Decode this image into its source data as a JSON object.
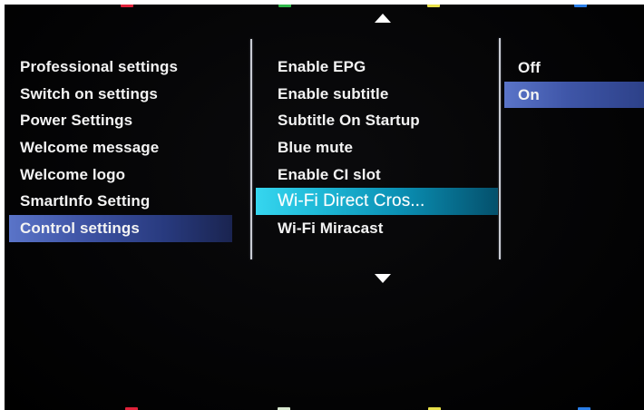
{
  "colors": {
    "background": "#000000",
    "left_selection": "#3d52a3",
    "focus_highlight": "#1fbad8",
    "right_selection": "#3f56a8",
    "text": "#f3f3f3"
  },
  "navigation": {
    "up_icon": "arrow-up-icon",
    "down_icon": "arrow-down-icon"
  },
  "menu": {
    "categories": [
      {
        "label": "Professional settings"
      },
      {
        "label": "Switch on settings"
      },
      {
        "label": "Power Settings"
      },
      {
        "label": "Welcome message"
      },
      {
        "label": "Welcome logo"
      },
      {
        "label": "SmartInfo Setting"
      },
      {
        "label": "Control settings"
      }
    ],
    "selected_category": "Control settings",
    "options": [
      {
        "label": "Enable EPG"
      },
      {
        "label": "Enable subtitle"
      },
      {
        "label": "Subtitle On Startup"
      },
      {
        "label": "Blue mute"
      },
      {
        "label": "Enable CI slot"
      },
      {
        "label": "Wi-Fi Direct Cros..."
      },
      {
        "label": "Wi-Fi Miracast"
      }
    ],
    "focused_option": "Wi-Fi Direct Cros...",
    "values": [
      {
        "label": "Off"
      },
      {
        "label": "On"
      }
    ],
    "selected_value": "On"
  }
}
